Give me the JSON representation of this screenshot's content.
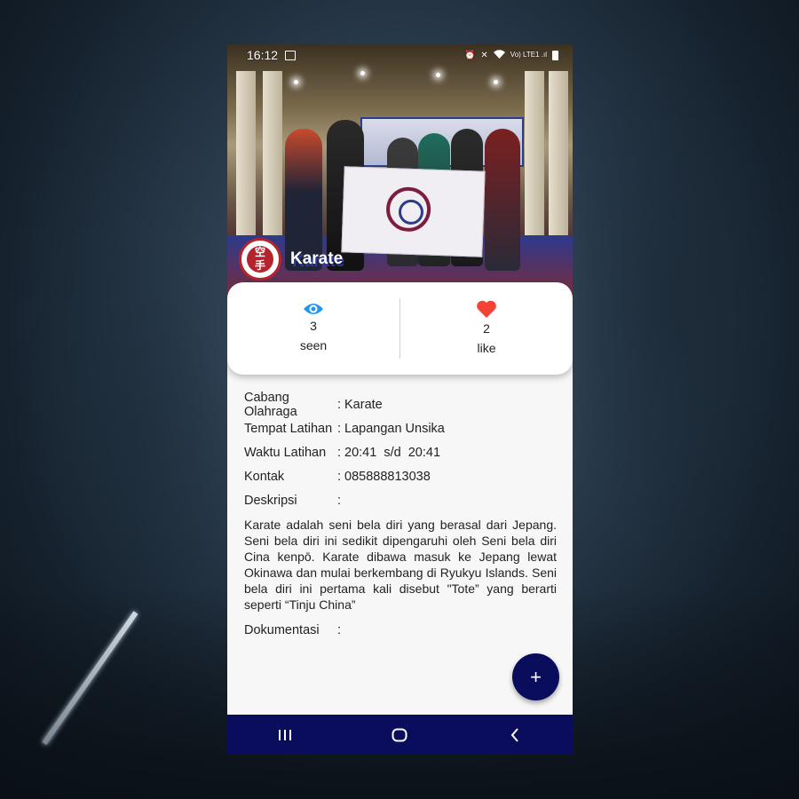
{
  "status_bar": {
    "time": "16:12",
    "network": "Vo) LTE1 .ıl"
  },
  "header": {
    "title": "Karate"
  },
  "stats": {
    "seen": {
      "count": "3",
      "label": "seen",
      "icon": "eye-icon",
      "color": "#2196f3"
    },
    "like": {
      "count": "2",
      "label": "like",
      "icon": "heart-icon",
      "color": "#f44336"
    }
  },
  "details": [
    {
      "label": "Cabang Olahraga",
      "sep": ":",
      "value": "Karate"
    },
    {
      "label": "Tempat Latihan",
      "sep": ":",
      "value": "Lapangan Unsika"
    },
    {
      "label": "Waktu Latihan",
      "sep": ":",
      "value": "20:41  s/d  20:41"
    },
    {
      "label": "Kontak",
      "sep": ":",
      "value": "085888813038"
    },
    {
      "label": "Deskripsi",
      "sep": ":",
      "value": ""
    }
  ],
  "description": "Karate adalah seni bela diri yang berasal dari Jepang. Seni bela diri ini sedikit dipengaruhi oleh Seni bela diri Cina kenpō. Karate dibawa masuk ke Jepang lewat Okinawa dan mulai berkembang di Ryukyu Islands. Seni bela diri ini pertama kali disebut \"Tote” yang berarti seperti “Tinju China”",
  "documentation": {
    "label": "Dokumentasi",
    "sep": ":"
  },
  "fab": {
    "label": "+"
  },
  "colors": {
    "primary": "#0a0d5c",
    "accent_eye": "#2196f3",
    "accent_heart": "#f44336"
  }
}
